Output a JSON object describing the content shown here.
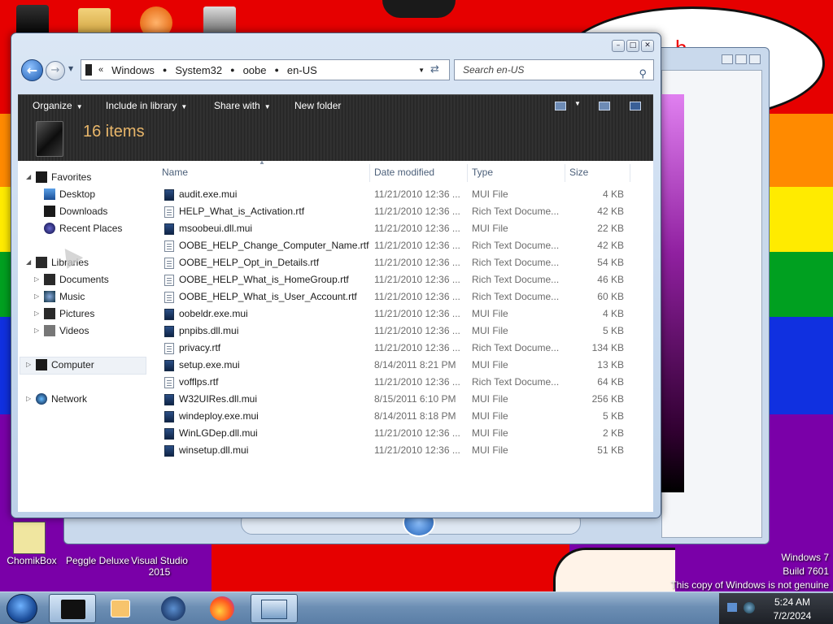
{
  "window": {
    "breadcrumb": [
      "Windows",
      "System32",
      "oobe",
      "en-US"
    ],
    "search_placeholder": "Search en-US"
  },
  "toolbar": {
    "organize": "Organize",
    "include_in_library": "Include in library",
    "share_with": "Share with",
    "new_folder": "New folder",
    "item_count": "16 items"
  },
  "nav": {
    "favorites": "Favorites",
    "desktop": "Desktop",
    "downloads": "Downloads",
    "recent_places": "Recent Places",
    "libraries": "Libraries",
    "documents": "Documents",
    "music": "Music",
    "pictures": "Pictures",
    "videos": "Videos",
    "computer": "Computer",
    "network": "Network"
  },
  "columns": {
    "name": "Name",
    "date": "Date modified",
    "type": "Type",
    "size": "Size"
  },
  "files": [
    {
      "name": "audit.exe.mui",
      "date": "11/21/2010 12:36 ...",
      "type": "MUI File",
      "size": "4 KB",
      "kind": "mui"
    },
    {
      "name": "HELP_What_is_Activation.rtf",
      "date": "11/21/2010 12:36 ...",
      "type": "Rich Text Docume...",
      "size": "42 KB",
      "kind": "rtf"
    },
    {
      "name": "msoobeui.dll.mui",
      "date": "11/21/2010 12:36 ...",
      "type": "MUI File",
      "size": "22 KB",
      "kind": "mui"
    },
    {
      "name": "OOBE_HELP_Change_Computer_Name.rtf",
      "date": "11/21/2010 12:36 ...",
      "type": "Rich Text Docume...",
      "size": "42 KB",
      "kind": "rtf"
    },
    {
      "name": "OOBE_HELP_Opt_in_Details.rtf",
      "date": "11/21/2010 12:36 ...",
      "type": "Rich Text Docume...",
      "size": "54 KB",
      "kind": "rtf"
    },
    {
      "name": "OOBE_HELP_What_is_HomeGroup.rtf",
      "date": "11/21/2010 12:36 ...",
      "type": "Rich Text Docume...",
      "size": "46 KB",
      "kind": "rtf"
    },
    {
      "name": "OOBE_HELP_What_is_User_Account.rtf",
      "date": "11/21/2010 12:36 ...",
      "type": "Rich Text Docume...",
      "size": "60 KB",
      "kind": "rtf"
    },
    {
      "name": "oobeldr.exe.mui",
      "date": "11/21/2010 12:36 ...",
      "type": "MUI File",
      "size": "4 KB",
      "kind": "mui"
    },
    {
      "name": "pnpibs.dll.mui",
      "date": "11/21/2010 12:36 ...",
      "type": "MUI File",
      "size": "5 KB",
      "kind": "mui"
    },
    {
      "name": "privacy.rtf",
      "date": "11/21/2010 12:36 ...",
      "type": "Rich Text Docume...",
      "size": "134 KB",
      "kind": "rtf"
    },
    {
      "name": "setup.exe.mui",
      "date": "8/14/2011 8:21 PM",
      "type": "MUI File",
      "size": "13 KB",
      "kind": "mui"
    },
    {
      "name": "vofflps.rtf",
      "date": "11/21/2010 12:36 ...",
      "type": "Rich Text Docume...",
      "size": "64 KB",
      "kind": "rtf"
    },
    {
      "name": "W32UIRes.dll.mui",
      "date": "8/15/2011 6:10 PM",
      "type": "MUI File",
      "size": "256 KB",
      "kind": "mui"
    },
    {
      "name": "windeploy.exe.mui",
      "date": "8/14/2011 8:18 PM",
      "type": "MUI File",
      "size": "5 KB",
      "kind": "mui"
    },
    {
      "name": "WinLGDep.dll.mui",
      "date": "11/21/2010 12:36 ...",
      "type": "MUI File",
      "size": "2 KB",
      "kind": "mui"
    },
    {
      "name": "winsetup.dll.mui",
      "date": "11/21/2010 12:36 ...",
      "type": "MUI File",
      "size": "51 KB",
      "kind": "mui"
    }
  ],
  "desktop": {
    "icons": [
      "ChomikBox",
      "Peggle Deluxe",
      "Visual Studio 2015"
    ],
    "watermark": [
      "Windows 7",
      "Build 7601",
      "This copy of Windows is not genuine"
    ]
  },
  "clock": {
    "time": "5:24 AM",
    "date": "7/2/2024"
  },
  "colors": {
    "accent": "#e8b66a",
    "desktop_red": "#e00000"
  }
}
